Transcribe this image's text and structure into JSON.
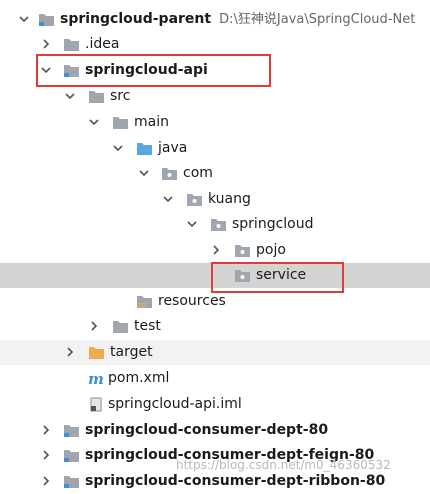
{
  "tree": {
    "root": {
      "label": "springcloud-parent",
      "path": "D:\\狂神说Java\\SpringCloud-Net"
    },
    "nodes": [
      {
        "label": ".idea"
      },
      {
        "label": "springcloud-api"
      },
      {
        "label": "src"
      },
      {
        "label": "main"
      },
      {
        "label": "java"
      },
      {
        "label": "com"
      },
      {
        "label": "kuang"
      },
      {
        "label": "springcloud"
      },
      {
        "label": "pojo"
      },
      {
        "label": "service"
      },
      {
        "label": "resources"
      },
      {
        "label": "test"
      },
      {
        "label": "target"
      },
      {
        "label": "pom.xml"
      },
      {
        "label": "springcloud-api.iml"
      },
      {
        "label": "springcloud-consumer-dept-80"
      },
      {
        "label": "springcloud-consumer-dept-feign-80"
      },
      {
        "label": "springcloud-consumer-dept-ribbon-80"
      }
    ]
  },
  "watermark": "https://blog.csdn.net/m0_46360532",
  "colors": {
    "selection_bg": "#d4d4d4",
    "highlight_border": "#e53a3a",
    "folder_grey": "#a0a6ad",
    "folder_blue": "#59a7e0",
    "folder_orange": "#f0a94c",
    "maven_blue": "#3d8fd6"
  }
}
